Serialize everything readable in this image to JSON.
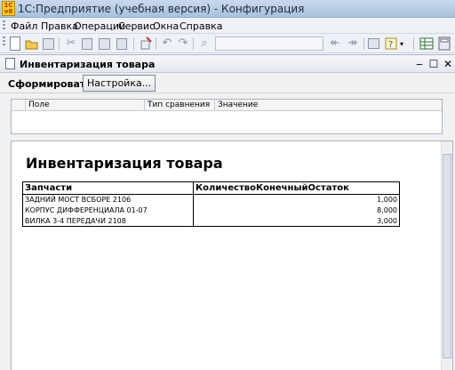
{
  "window": {
    "title": "1С:Предприятие (учебная версия) - Конфигурация",
    "icon_text": "1С v8"
  },
  "menu": [
    "Файл",
    "Правка",
    "Операции",
    "Сервис",
    "Окна",
    "Справка"
  ],
  "form": {
    "title": "Инвентаризация товара",
    "generate_label": "Сформировать",
    "settings_label": "Настройка...",
    "settings_columns": [
      "Поле",
      "Тип сравнения",
      "Значение"
    ]
  },
  "report": {
    "title": "Инвентаризация товара",
    "headers": [
      "Запчасти",
      "КоличествоКонечныйОстаток"
    ],
    "rows": [
      {
        "name": "ЗАДНИЙ МОСТ ВСБОРЕ 2106",
        "qty": "1,000"
      },
      {
        "name": "КОРПУС ДИФФЕРЕНЦИАЛА 01-07",
        "qty": "8,000"
      },
      {
        "name": "ВИЛКА 3-4  ПЕРЕДАЧИ 2108",
        "qty": "3,000"
      }
    ]
  }
}
